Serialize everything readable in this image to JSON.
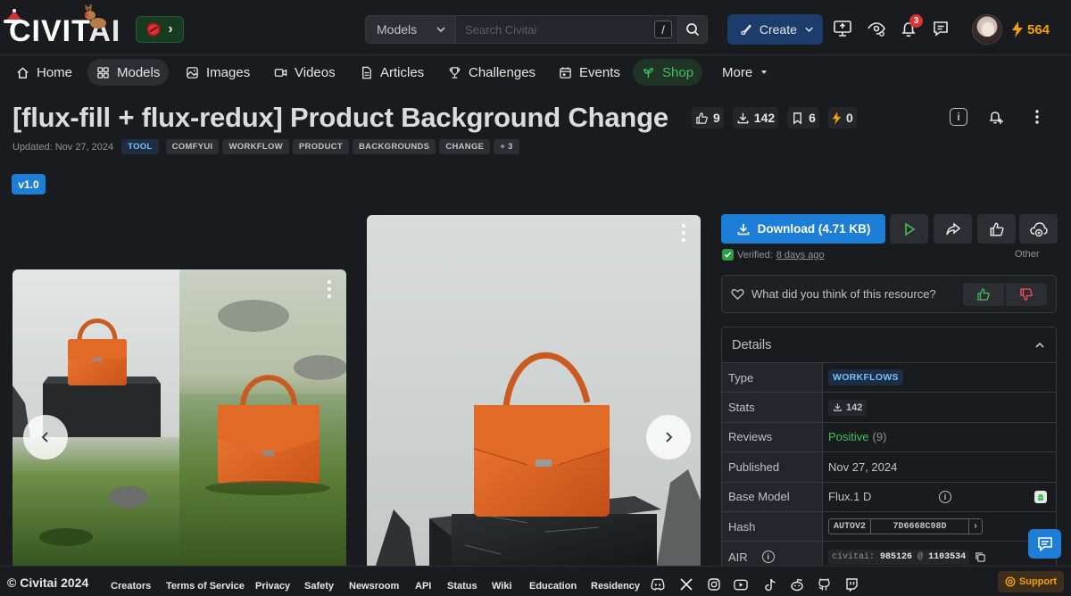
{
  "header": {
    "logo_main": "CIVIT",
    "logo_ai": "AI",
    "search_scope": "Models",
    "search_placeholder": "Search Civitai",
    "search_shortcut": "/",
    "create_label": "Create",
    "notification_count": "3",
    "buzz_amount": "564"
  },
  "nav": {
    "items": [
      {
        "label": "Home",
        "icon": "home-icon"
      },
      {
        "label": "Models",
        "icon": "grid-icon"
      },
      {
        "label": "Images",
        "icon": "image-icon"
      },
      {
        "label": "Videos",
        "icon": "video-icon"
      },
      {
        "label": "Articles",
        "icon": "document-icon"
      },
      {
        "label": "Challenges",
        "icon": "trophy-icon"
      },
      {
        "label": "Events",
        "icon": "calendar-icon"
      },
      {
        "label": "Shop",
        "icon": "leaf-icon"
      },
      {
        "label": "More",
        "icon": "caret-down-icon"
      }
    ],
    "active": "Models"
  },
  "model": {
    "title": "[flux-fill + flux-redux] Product Background Change",
    "likes": "9",
    "downloads": "142",
    "collected": "6",
    "tipped": "0",
    "updated": "Updated: Nov 27, 2024",
    "type_tag": "TOOL",
    "tags": [
      "COMFYUI",
      "WORKFLOW",
      "PRODUCT",
      "BACKGROUNDS",
      "CHANGE"
    ],
    "more_tags": "+ 3",
    "version": "v1.0"
  },
  "panel": {
    "download_label": "Download (4.71 KB)",
    "verified_prefix": "Verified:",
    "verified_when": "8 days ago",
    "file_kind": "Other",
    "feedback_prompt": "What did you think of this resource?",
    "details_title": "Details",
    "details": {
      "type_label": "Type",
      "type_value": "WORKFLOWS",
      "stats_label": "Stats",
      "stats_value": "142",
      "reviews_label": "Reviews",
      "reviews_value": "Positive",
      "reviews_count": "(9)",
      "published_label": "Published",
      "published_value": "Nov 27, 2024",
      "base_label": "Base Model",
      "base_value": "Flux.1 D",
      "hash_label": "Hash",
      "hash_type": "AUTOV2",
      "hash_value": "7D6668C98D",
      "air_label": "AIR",
      "air_prefix": "civitai:",
      "air_model": "985126",
      "air_at": "@",
      "air_version": "1103534"
    }
  },
  "footer": {
    "copyright": "© Civitai 2024",
    "links": [
      "Creators",
      "Terms of Service",
      "Privacy",
      "Safety",
      "Newsroom",
      "API",
      "Status",
      "Wiki",
      "Education",
      "Residency"
    ],
    "socials": [
      "discord-icon",
      "x-icon",
      "instagram-icon",
      "youtube-icon",
      "tiktok-icon",
      "reddit-icon",
      "github-icon",
      "twitch-icon"
    ],
    "support_label": "Support"
  },
  "colors": {
    "background": "#1a1b1e",
    "accent_blue": "#1c7ed6",
    "positive_green": "#40c057",
    "buzz_orange": "#f59f00",
    "bag_orange": "#e06a26"
  }
}
